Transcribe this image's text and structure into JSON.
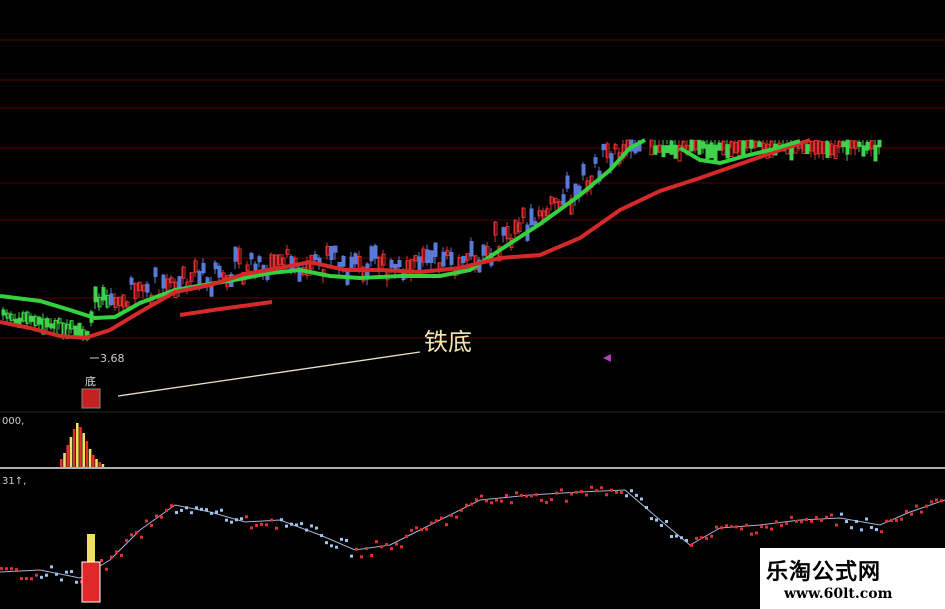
{
  "annotations": {
    "price_low": "3.68",
    "bottom_badge": "底",
    "callout": "铁底",
    "panel2_label": "000,",
    "panel3_label": "31↑,"
  },
  "watermark": {
    "title": "乐淘公式网",
    "url": "www.60lt.com"
  },
  "colors": {
    "background": "#000000",
    "grid": "#8b0000",
    "ma_fast": "#35d13f",
    "ma_slow": "#d42a2a",
    "candle_up": "#e03030",
    "candle_down": "#3fd24a",
    "callout": "#f3e6b0"
  }
}
